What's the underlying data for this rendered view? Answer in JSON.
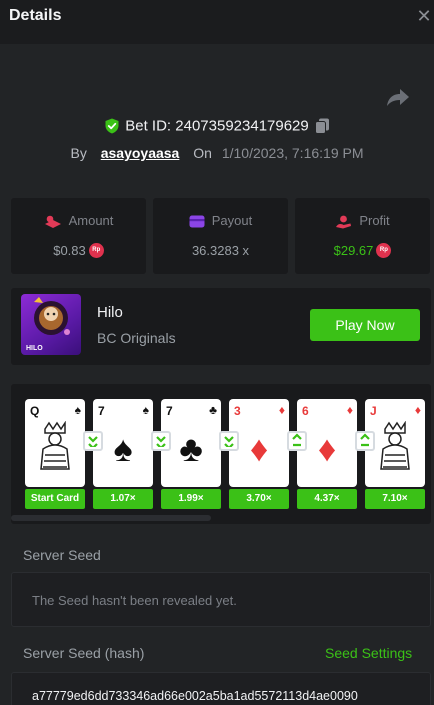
{
  "header": {
    "title": "Details",
    "close_icon": "close-icon"
  },
  "bet": {
    "id_text": "Bet ID: 2407359234179629",
    "by_label": "By",
    "username": "asayoyaasa",
    "on_label": "On",
    "timestamp": "1/10/2023, 7:16:19 PM"
  },
  "stats": {
    "amount": {
      "label": "Amount",
      "value": "$0.83",
      "currency_badge": "Rp",
      "icon": "stack-icon"
    },
    "payout": {
      "label": "Payout",
      "value": "36.3283 x",
      "icon": "payout-card-icon"
    },
    "profit": {
      "label": "Profit",
      "value": "$29.67",
      "currency_badge": "Rp",
      "icon": "hand-coin-icon"
    }
  },
  "game": {
    "name": "Hilo",
    "provider": "BC Originals",
    "thumb_label": "HILO",
    "play_label": "Play Now"
  },
  "cards": [
    {
      "rank": "Q",
      "suit": "♠",
      "color": "#111111",
      "face": true,
      "multiplier": "Start Card"
    },
    {
      "rank": "7",
      "suit": "♠",
      "color": "#111111",
      "face": false,
      "multiplier": "1.07×",
      "arrow": "down"
    },
    {
      "rank": "7",
      "suit": "♣",
      "color": "#111111",
      "face": false,
      "multiplier": "1.99×",
      "arrow": "down"
    },
    {
      "rank": "3",
      "suit": "♦",
      "color": "#e83a3a",
      "face": false,
      "multiplier": "3.70×",
      "arrow": "down"
    },
    {
      "rank": "6",
      "suit": "♦",
      "color": "#e83a3a",
      "face": false,
      "multiplier": "4.37×",
      "arrow": "up"
    },
    {
      "rank": "J",
      "suit": "♦",
      "color": "#e83a3a",
      "face": true,
      "multiplier": "7.10×",
      "arrow": "up"
    }
  ],
  "server_seed": {
    "label": "Server Seed",
    "message": "The Seed hasn't been revealed yet."
  },
  "server_seed_hash": {
    "label": "Server Seed (hash)",
    "settings_label": "Seed Settings",
    "hash": "a77779ed6dd733346ad66e002a5ba1ad5572113d4ae0090"
  },
  "colors": {
    "accent": "#3bc117",
    "background": "#222426",
    "panel": "#191a1c",
    "rp_badge": "#e0324e"
  }
}
